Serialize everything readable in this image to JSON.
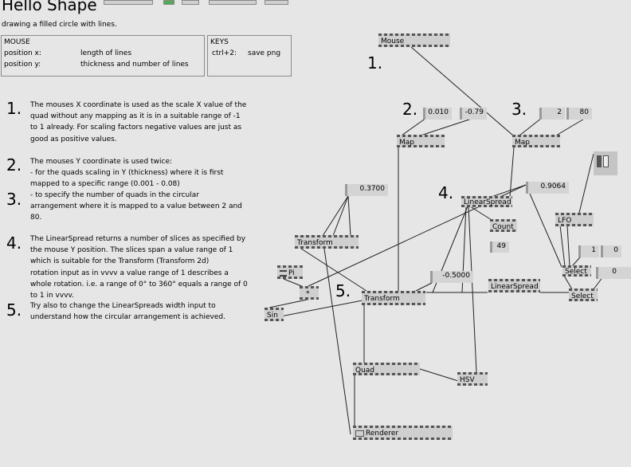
{
  "header": {
    "title": "Hello Shape",
    "subtitle": "drawing a filled circle with lines."
  },
  "mouse_box": {
    "heading": "MOUSE",
    "rows": [
      {
        "input": "position x:",
        "effect": "length of lines"
      },
      {
        "input": "position y:",
        "effect": "thickness and number of lines"
      }
    ]
  },
  "keys_box": {
    "heading": "KEYS",
    "rows": [
      {
        "key": "ctrl+2:",
        "effect": "save png"
      }
    ]
  },
  "steps": [
    {
      "number": "1.",
      "lines": [
        "The mouses X coordinate is used as the scale X value of the",
        "quad without any mapping as it is in a suitable range of -1",
        "to 1 already. For scaling factors negative values are just as",
        "good as positive values."
      ]
    },
    {
      "number": "2.",
      "lines": [
        "The mouses Y coordinate is used twice:",
        "- for the quads scaling in Y (thickness) where it is first",
        "mapped to a specific range (0.001 - 0.08)"
      ]
    },
    {
      "number": "3.",
      "lines": [
        "- to specify the number of quads in the circular",
        "arrangement where it is mapped to a value between 2 and",
        "80."
      ]
    },
    {
      "number": "4.",
      "lines": [
        "The LinearSpread returns a number of slices as specified by",
        "the mouse Y position. The slices span a value range of 1",
        "which is suitable for the Transform (Transform 2d)",
        "rotation input as in vvvv a value range of 1 describes a",
        "whole rotation. i.e. a range of 0° to 360° equals a range of 0",
        "to 1 in vvvv."
      ]
    },
    {
      "number": "5.",
      "lines": [
        "Try also to change the LinearSpreads width input to",
        "understand how the circular arrangement is achieved."
      ]
    }
  ],
  "patch_labels": {
    "l1": "1.",
    "l2": "2.",
    "l3": "3.",
    "l4": "4.",
    "l5": "5."
  },
  "nodes": {
    "mouse": "Mouse",
    "map1": "Map",
    "map2": "Map",
    "linearspread1": "LinearSpread",
    "count": "Count",
    "transform_small": "Transform",
    "pi": "Pi",
    "mult": "*",
    "sin": "Sin",
    "transform_main": "Transform",
    "linearspread2": "LinearSpread",
    "lfo": "LFO",
    "select1": "Select",
    "select2": "Select",
    "quad": "Quad",
    "hsv": "HSV",
    "renderer": "Renderer"
  },
  "values": {
    "map_min": "0.010",
    "map_max": "-0.79",
    "range_min": "2",
    "range_max": "80",
    "v_03700": "0.3700",
    "v_09064": "0.9064",
    "v_count": "49",
    "v_neg05": "-0.5000",
    "sel_a": "1",
    "sel_b": "0",
    "sel_c": "0"
  }
}
